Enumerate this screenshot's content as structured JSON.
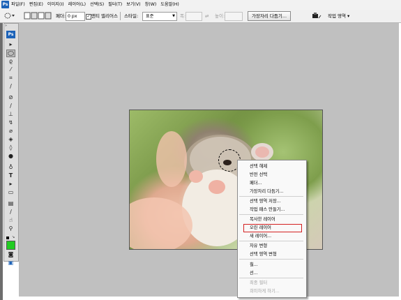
{
  "menubar": {
    "items": [
      "파일(F)",
      "편집(E)",
      "이미지(I)",
      "레이어(L)",
      "선택(S)",
      "필터(T)",
      "보기(V)",
      "창(W)",
      "도움말(H)"
    ]
  },
  "options": {
    "feather_label": "페더:",
    "feather_value": "0 px",
    "antialias_label": "앤티 앨리어스",
    "style_label": "스타일:",
    "style_value": "표준",
    "width_label": "폭:",
    "height_label": "높이:",
    "refine_edge_button": "가장자리 다듬기...",
    "workspace_button": "작업 영역 ▾"
  },
  "context_menu": {
    "items": [
      {
        "label": "선택 해제",
        "enabled": true
      },
      {
        "label": "반전 선택",
        "enabled": true
      },
      {
        "label": "페더...",
        "enabled": true
      },
      {
        "label": "가장자리 다듬기...",
        "enabled": true
      },
      {
        "label": "선택 영역 저장...",
        "enabled": true
      },
      {
        "label": "작업 패스 만들기...",
        "enabled": true
      },
      {
        "label": "복사한 레이어",
        "enabled": true
      },
      {
        "label": "오린 레이어",
        "enabled": true,
        "highlighted": true
      },
      {
        "label": "새 레이어...",
        "enabled": true
      },
      {
        "label": "자유 변형",
        "enabled": true
      },
      {
        "label": "선택 영역 변형",
        "enabled": true
      },
      {
        "label": "칠...",
        "enabled": true
      },
      {
        "label": "선...",
        "enabled": true
      },
      {
        "label": "최종 필터",
        "enabled": false
      },
      {
        "label": "희미하게 하기...",
        "enabled": false
      }
    ]
  },
  "colors": {
    "accent": "#1d63b8",
    "highlight_box": "#d42020",
    "foreground_swatch": "#000000",
    "background_swatch": "#22cc22"
  },
  "toolbox": {
    "logo": "Ps",
    "tools": [
      "move-icon",
      "marquee-icon",
      "lasso-icon",
      "magic-wand-icon",
      "crop-icon",
      "eyedropper-icon",
      "healing-brush-icon",
      "brush-icon",
      "clone-stamp-icon",
      "history-brush-icon",
      "eraser-icon",
      "paint-bucket-icon",
      "blur-icon",
      "dodge-icon",
      "pen-icon",
      "type-icon",
      "path-select-icon",
      "shape-icon",
      "notes-icon",
      "eyedropper2-icon",
      "hand-icon",
      "zoom-icon"
    ]
  }
}
